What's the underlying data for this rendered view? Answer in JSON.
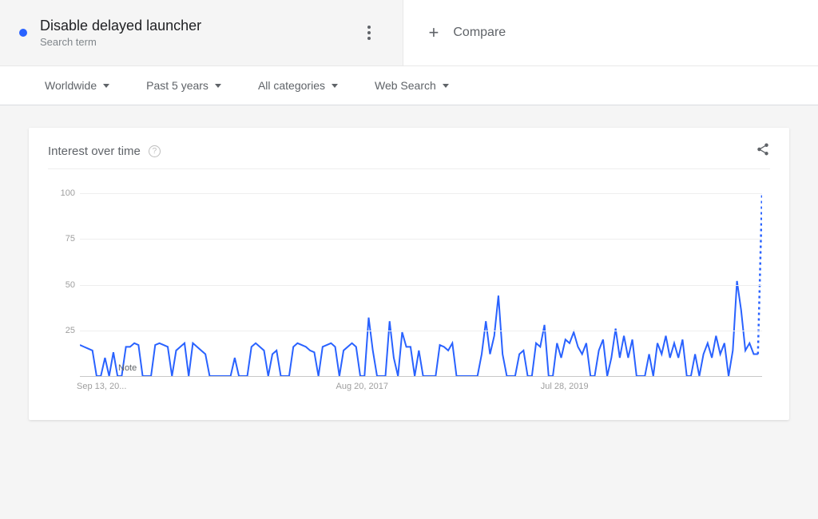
{
  "term": {
    "title": "Disable delayed launcher",
    "subtitle": "Search term",
    "color": "#2962ff"
  },
  "compare": {
    "label": "Compare"
  },
  "filters": {
    "region": "Worldwide",
    "time": "Past 5 years",
    "category": "All categories",
    "type": "Web Search"
  },
  "card": {
    "title": "Interest over time"
  },
  "note": "Note",
  "chart_data": {
    "type": "line",
    "title": "Interest over time",
    "ylabel": "",
    "xlabel": "",
    "ylim": [
      0,
      100
    ],
    "y_ticks": [
      25,
      50,
      75,
      100
    ],
    "x_ticks": [
      "Sep 13, 20...",
      "Aug 20, 2017",
      "Jul 28, 2019"
    ],
    "values": [
      17,
      16,
      15,
      14,
      0,
      0,
      10,
      0,
      13,
      0,
      0,
      16,
      16,
      18,
      17,
      0,
      0,
      0,
      17,
      18,
      17,
      16,
      0,
      14,
      16,
      18,
      0,
      18,
      16,
      14,
      12,
      0,
      0,
      0,
      0,
      0,
      0,
      10,
      0,
      0,
      0,
      16,
      18,
      16,
      14,
      0,
      12,
      14,
      0,
      0,
      0,
      16,
      18,
      17,
      16,
      14,
      13,
      0,
      16,
      17,
      18,
      16,
      0,
      14,
      16,
      18,
      16,
      0,
      0,
      32,
      14,
      0,
      0,
      0,
      30,
      10,
      0,
      24,
      16,
      16,
      0,
      14,
      0,
      0,
      0,
      0,
      17,
      16,
      14,
      18,
      0,
      0,
      0,
      0,
      0,
      0,
      12,
      30,
      12,
      22,
      44,
      12,
      0,
      0,
      0,
      12,
      14,
      0,
      0,
      18,
      16,
      28,
      0,
      0,
      18,
      10,
      20,
      18,
      24,
      16,
      12,
      18,
      0,
      0,
      14,
      20,
      0,
      10,
      26,
      10,
      22,
      10,
      20,
      0,
      0,
      0,
      12,
      0,
      18,
      12,
      22,
      10,
      18,
      10,
      20,
      0,
      0,
      12,
      0,
      12,
      18,
      10,
      22,
      12,
      18,
      0,
      14,
      52,
      36,
      14,
      18,
      12,
      12,
      100
    ],
    "forecast_last": true
  }
}
